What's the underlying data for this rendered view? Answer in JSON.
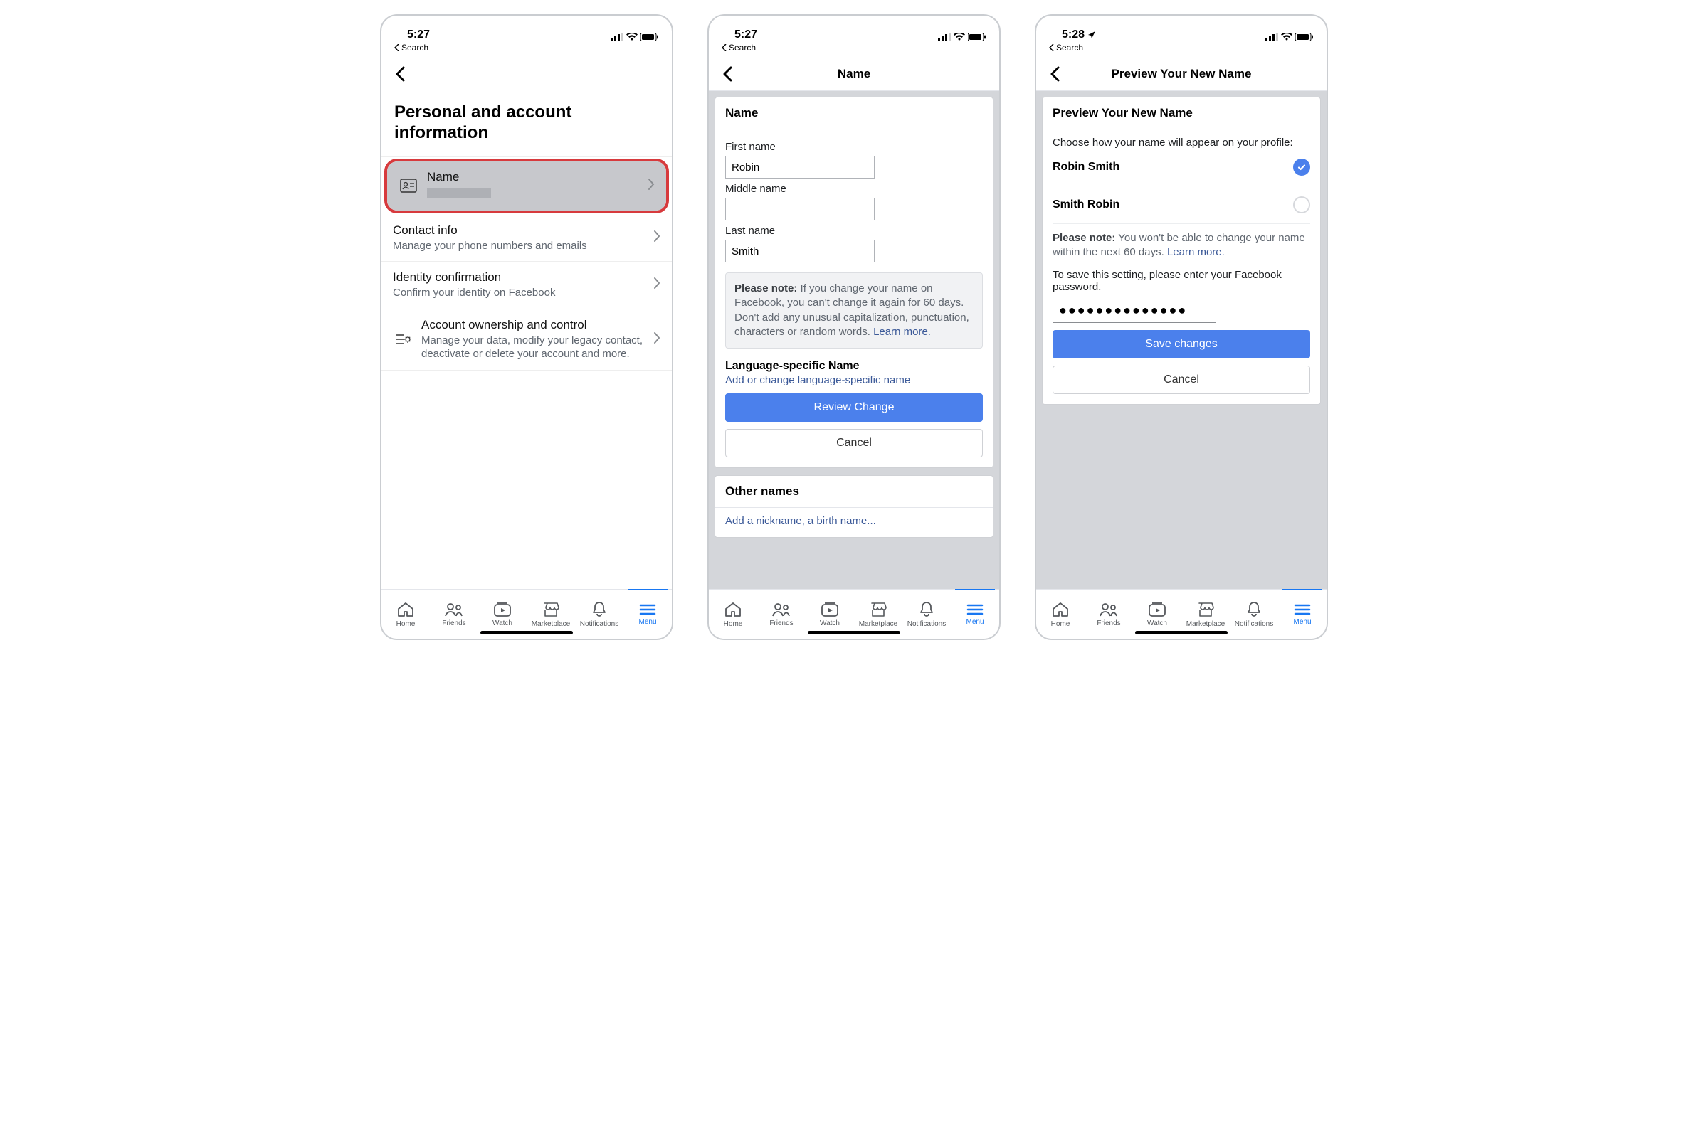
{
  "status": {
    "time_a": "5:27",
    "time_b": "5:27",
    "time_c": "5:28",
    "back_search": "Search"
  },
  "screen1": {
    "page_title": "Personal and account information",
    "rows": {
      "name": {
        "title": "Name"
      },
      "contact": {
        "title": "Contact info",
        "sub": "Manage your phone numbers and emails"
      },
      "identity": {
        "title": "Identity confirmation",
        "sub": "Confirm your identity on Facebook"
      },
      "ownership": {
        "title": "Account ownership and control",
        "sub": "Manage your data, modify your legacy contact, deactivate or delete your account and more."
      }
    }
  },
  "screen2": {
    "header": "Name",
    "card_title": "Name",
    "first_label": "First name",
    "first_value": "Robin",
    "middle_label": "Middle name",
    "middle_value": "",
    "last_label": "Last name",
    "last_value": "Smith",
    "note_bold": "Please note:",
    "note_text": " If you change your name on Facebook, you can't change it again for 60 days. Don't add any unusual capitalization, punctuation, characters or random words. ",
    "learn_more": "Learn more.",
    "lang_title": "Language-specific Name",
    "lang_link": "Add or change language-specific name",
    "review_btn": "Review Change",
    "cancel_btn": "Cancel",
    "other_title": "Other names",
    "other_link": "Add a nickname, a birth name..."
  },
  "screen3": {
    "header": "Preview Your New Name",
    "card_title": "Preview Your New Name",
    "instruction": "Choose how your name will appear on your profile:",
    "opt1": "Robin Smith",
    "opt2": "Smith Robin",
    "note_bold": "Please note:",
    "note_text": " You won't be able to change your name within the next 60 days. ",
    "learn_more": "Learn more.",
    "pw_instruction": "To save this setting, please enter your Facebook password.",
    "pw_value": "●●●●●●●●●●●●●●",
    "save_btn": "Save changes",
    "cancel_btn": "Cancel"
  },
  "tabs": {
    "home": "Home",
    "friends": "Friends",
    "watch": "Watch",
    "marketplace": "Marketplace",
    "notifications": "Notifications",
    "menu": "Menu"
  }
}
